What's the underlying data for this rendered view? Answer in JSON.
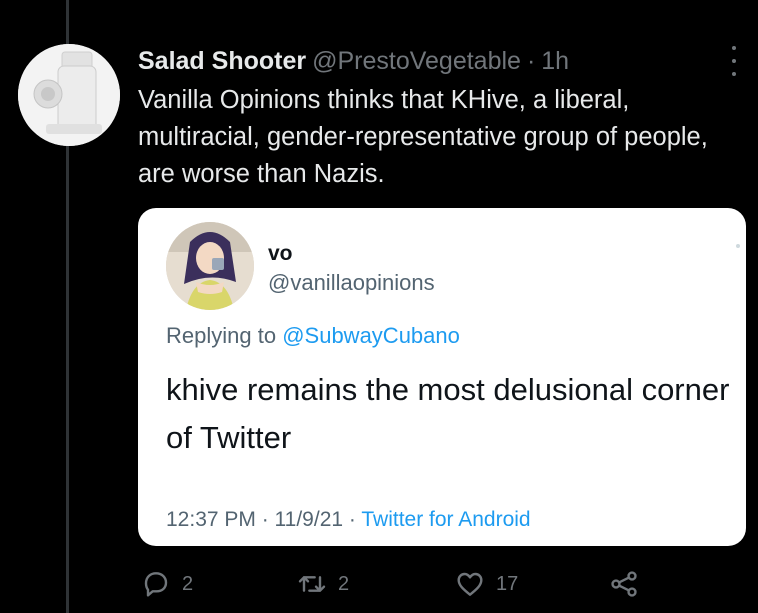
{
  "tweet": {
    "display_name": "Salad Shooter",
    "handle": "@PrestoVegetable",
    "separator": "·",
    "time": "1h",
    "text": "Vanilla Opinions thinks that KHive, a liberal, multiracial, gender-representative group of people, are worse than Nazis."
  },
  "quoted": {
    "display_name": "vo",
    "handle": "@vanillaopinions",
    "replying_prefix": "Replying to",
    "replying_to": "@SubwayCubano",
    "text": "khive remains the most delusional corner of Twitter",
    "timestamp": "12:37 PM · 11/9/21 ·",
    "source": "Twitter for Android"
  },
  "actions": {
    "replies": "2",
    "retweets": "2",
    "likes": "17"
  },
  "icons": {
    "more": "more-dots-icon",
    "reply": "reply-icon",
    "retweet": "retweet-icon",
    "like": "heart-icon",
    "share": "share-icon"
  },
  "colors": {
    "background": "#000000",
    "text": "#e7e9ea",
    "muted": "#71767b",
    "link": "#1d9bf0",
    "card": "#ffffff"
  }
}
